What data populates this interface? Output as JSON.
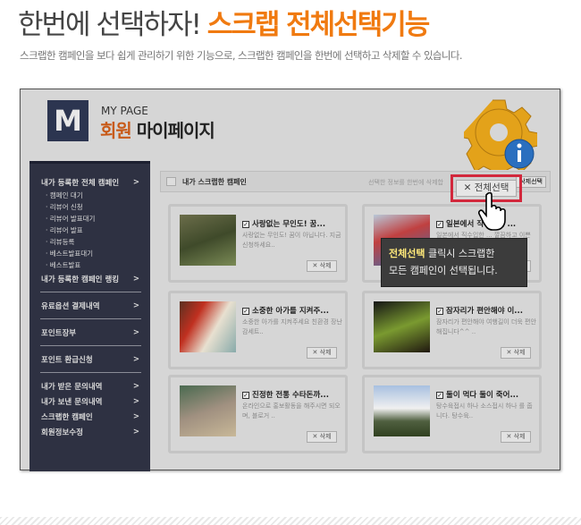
{
  "header": {
    "title_plain": "한번에 선택하자!",
    "title_highlight": "스크랩 전체선택기능",
    "subtitle": "스크랩한 캠페인을 보다 쉽게 관리하기 위한 기능으로, 스크랩한 캠페인을 한번에 선택하고 삭제할 수 있습니다."
  },
  "mypage": {
    "logo": "M",
    "label": "MY PAGE",
    "title_accent": "회원",
    "title_rest": "마이페이지"
  },
  "sidebar": {
    "chevron": ">",
    "items": [
      {
        "label": "내가 등록한 전체 캠페인",
        "subs": [
          "· 캠페인 대기",
          "· 리뷰어 신청",
          "· 리뷰어 발표대기",
          "· 리뷰어 발표",
          "· 리뷰등록",
          "· 베스트발표대기",
          "· 베스트발표"
        ]
      },
      {
        "label": "내가 등록한 캠페인 랭킹"
      },
      {
        "label": "유료옵션 결제내역"
      },
      {
        "label": "포인트장부"
      },
      {
        "label": "포인트 환급신청"
      },
      {
        "label": "내가 받은 문의내역"
      },
      {
        "label": "내가 보낸 문의내역"
      },
      {
        "label": "스크랩한 캠페인"
      },
      {
        "label": "회원정보수정"
      }
    ]
  },
  "content": {
    "section_title": "내가 스크랩한 캠페인",
    "info": "선택한 정보를 한번에 삭제합",
    "delete_selected": "삭제선택",
    "select_all": "✕ 전체선택",
    "cards": [
      {
        "title": "사랑없는 무인도! 꿈...",
        "desc": "사랑없는 무인도! 꿈이 아닙니다. 지금 신청하세요..",
        "delete": "✕ 삭제"
      },
      {
        "title": "일본에서 직수입한 ...",
        "desc": "일본에서 직수입한 ... 깔끔하고 이쁜 가두드 소품 ...",
        "delete": "✕ 삭제"
      },
      {
        "title": "소중한 아가를 지켜주...",
        "desc": "소중한 아가를 지켜주세요 친환경 장난감세트..",
        "delete": "✕ 삭제"
      },
      {
        "title": "잠자리가 편안해야 이...",
        "desc": "잠자리가 편안해야 여행길이 더욱 편안해집니다^^ ..",
        "delete": "✕ 삭제"
      },
      {
        "title": "진정한 전통 수타돈까...",
        "desc": "온라인으로 홍보활동을 해주시면 되오며, 블로거 ..",
        "delete": "✕ 삭제"
      },
      {
        "title": "둘이 먹다 둘이 죽어...",
        "desc": "탕수육접시 하나 소스접시 하나 를 줍니다. 탕수육..",
        "delete": "✕ 삭제"
      }
    ]
  },
  "tooltip": {
    "bold": "전체선택",
    "rest1": " 클릭시 스크랩한",
    "line2": "모든 캠페인이 선택됩니다."
  }
}
